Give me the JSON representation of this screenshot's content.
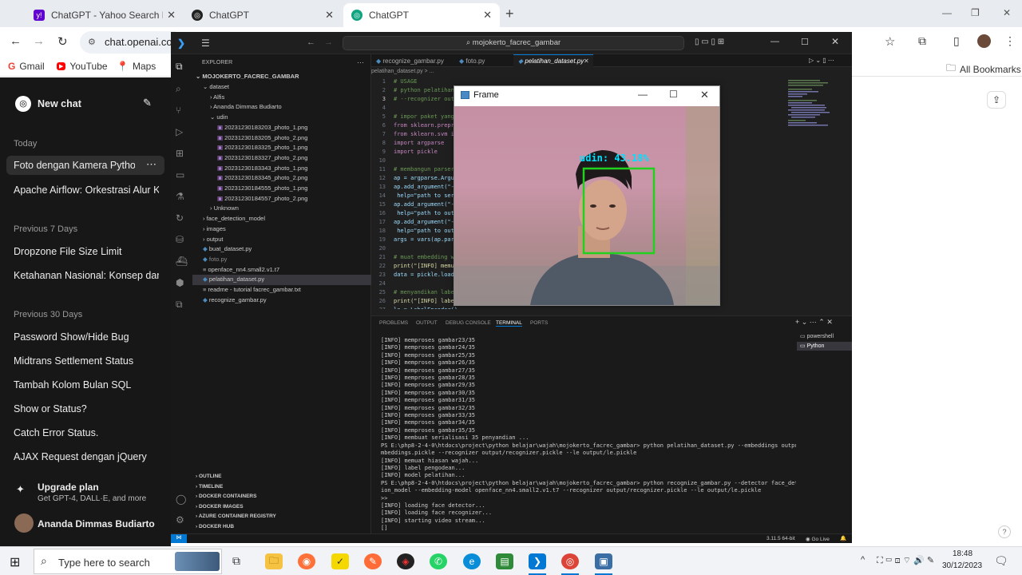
{
  "browser": {
    "tabs": [
      {
        "title": "ChatGPT - Yahoo Search Results",
        "icon": "yahoo-icon"
      },
      {
        "title": "ChatGPT",
        "icon": "openai-icon"
      },
      {
        "title": "ChatGPT",
        "icon": "openai-icon"
      }
    ],
    "new_tab": "+",
    "url": "chat.openai.com",
    "bookmarks": [
      "Gmail",
      "YouTube",
      "Maps"
    ],
    "all_bookmarks": "All Bookmarks",
    "window_controls": [
      "—",
      "❐",
      "✕"
    ]
  },
  "chatgpt": {
    "new_chat": "New chat",
    "sections": [
      {
        "label": "Today",
        "items": [
          "Foto dengan Kamera Python",
          "Apache Airflow: Orkestrasi Alur Kerja"
        ]
      },
      {
        "label": "Previous 7 Days",
        "items": [
          "Dropzone File Size Limit",
          "Ketahanan Nasional: Konsep dan"
        ]
      },
      {
        "label": "Previous 30 Days",
        "items": [
          "Password Show/Hide Bug",
          "Midtrans Settlement Status",
          "Tambah Kolom Bulan SQL",
          "Show or Status?",
          "Catch Error Status.",
          "AJAX Request dengan jQuery"
        ]
      }
    ],
    "upgrade_title": "Upgrade plan",
    "upgrade_sub": "Get GPT-4, DALL·E, and more",
    "user": "Ananda Dimmas Budiarto"
  },
  "vscode": {
    "search": "mojokerto_facrec_gambar",
    "explorer_title": "EXPLORER",
    "project": "MOJOKERTO_FACREC_GAMBAR",
    "tree": [
      {
        "label": "dataset",
        "indent": 1,
        "kind": "folder-open"
      },
      {
        "label": "Alfis",
        "indent": 2,
        "kind": "folder"
      },
      {
        "label": "Ananda Dimmas Budiarto",
        "indent": 2,
        "kind": "folder"
      },
      {
        "label": "udin",
        "indent": 2,
        "kind": "folder-open"
      },
      {
        "label": "20231230183203_photo_1.png",
        "indent": 3,
        "kind": "img"
      },
      {
        "label": "20231230183205_photo_2.png",
        "indent": 3,
        "kind": "img"
      },
      {
        "label": "20231230183325_photo_1.png",
        "indent": 3,
        "kind": "img"
      },
      {
        "label": "20231230183327_photo_2.png",
        "indent": 3,
        "kind": "img"
      },
      {
        "label": "20231230183343_photo_1.png",
        "indent": 3,
        "kind": "img"
      },
      {
        "label": "20231230183345_photo_2.png",
        "indent": 3,
        "kind": "img"
      },
      {
        "label": "20231230184555_photo_1.png",
        "indent": 3,
        "kind": "img"
      },
      {
        "label": "20231230184557_photo_2.png",
        "indent": 3,
        "kind": "img"
      },
      {
        "label": "Unknown",
        "indent": 2,
        "kind": "folder"
      },
      {
        "label": "face_detection_model",
        "indent": 1,
        "kind": "folder"
      },
      {
        "label": "images",
        "indent": 1,
        "kind": "folder"
      },
      {
        "label": "output",
        "indent": 1,
        "kind": "folder"
      },
      {
        "label": "buat_dataset.py",
        "indent": 1,
        "kind": "py"
      },
      {
        "label": "foto.py",
        "indent": 1,
        "kind": "py-dim"
      },
      {
        "label": "openface_nn4.small2.v1.t7",
        "indent": 1,
        "kind": "file"
      },
      {
        "label": "pelatihan_dataset.py",
        "indent": 1,
        "kind": "py-sel"
      },
      {
        "label": "readme - tutorial facrec_gambar.txt",
        "indent": 1,
        "kind": "txt"
      },
      {
        "label": "recognize_gambar.py",
        "indent": 1,
        "kind": "py"
      }
    ],
    "bottom_sections": [
      "OUTLINE",
      "TIMELINE",
      "DOCKER CONTAINERS",
      "DOCKER IMAGES",
      "AZURE CONTAINER REGISTRY",
      "DOCKER HUB"
    ],
    "editor_tabs": [
      "recognize_gambar.py",
      "foto.py",
      "pelatihan_dataset.py"
    ],
    "breadcrumb": "pelatihan_dataset.py > ...",
    "code": [
      "# USAGE",
      "# python pelatihan_dataset.py --embeddings output/embeddings.pickle",
      "#   --recognizer output/recognizer.pickle --le output/le.pickle",
      "",
      "# impor paket yang diperlukan",
      "from sklearn.preprocessing import LabelEncoder",
      "from sklearn.svm import SVC",
      "import argparse",
      "import pickle",
      "",
      "# membangun parser argumen dan mengurai argumen",
      "ap = argparse.ArgumentParser()",
      "ap.add_argument(\"-e\", \"--embeddings\", required=True,",
      "    help=\"path to serialized db of facial embeddings\")",
      "ap.add_argument(\"-r\", \"--recognizer\", required=True,",
      "    help=\"path to output model trained to recognize faces\")",
      "ap.add_argument(\"-l\", \"--le\", required=True,",
      "    help=\"path to output label encoder\")",
      "args = vars(ap.parse_args())",
      "",
      "# muat embedding wajah",
      "print(\"[INFO] memuat hiasan wajah...\")",
      "data = pickle.loads(open(args[\"embeddings\"], \"rb\").read())",
      "",
      "# menyandikan label",
      "print(\"[INFO] label pengodean...\")",
      "le = LabelEncoder()"
    ],
    "panel_tabs": [
      "PROBLEMS",
      "OUTPUT",
      "DEBUG CONSOLE",
      "TERMINAL",
      "PORTS"
    ],
    "terminal": [
      "[INFO] memproses gambar23/35",
      "[INFO] memproses gambar24/35",
      "[INFO] memproses gambar25/35",
      "[INFO] memproses gambar26/35",
      "[INFO] memproses gambar27/35",
      "[INFO] memproses gambar28/35",
      "[INFO] memproses gambar29/35",
      "[INFO] memproses gambar30/35",
      "[INFO] memproses gambar31/35",
      "[INFO] memproses gambar32/35",
      "[INFO] memproses gambar33/35",
      "[INFO] memproses gambar34/35",
      "[INFO] memproses gambar35/35",
      "[INFO] membuat serialisasi 35 penyandian ...",
      "PS E:\\php8-2-4-0\\htdocs\\project\\python belajar\\wajah\\mojokerto_facrec_gambar> python pelatihan_dataset.py --embeddings output/e",
      "mbeddings.pickle --recognizer output/recognizer.pickle --le output/le.pickle",
      "[INFO] memuat hiasan wajah...",
      "[INFO] label pengodean...",
      "[INFO] model pelatihan...",
      "PS E:\\php8-2-4-0\\htdocs\\project\\python belajar\\wajah\\mojokerto_facrec_gambar> python recognize_gambar.py --detector face_detect",
      "ion_model --embedding-model openface_nn4.small2.v1.t7 --recognizer output/recognizer.pickle --le output/le.pickle",
      ">>",
      "[INFO] loading face detector...",
      "[INFO] loading face recognizer...",
      "[INFO] starting video stream...",
      "[]"
    ],
    "terminals": [
      "powershell",
      "Python"
    ],
    "status_right": [
      "3.11.5 64-bit",
      "Go Live"
    ]
  },
  "frame": {
    "title": "Frame",
    "label": "udin: 43.18%",
    "confidence": 43.18
  },
  "taskbar": {
    "search": "Type here to search",
    "time": "18:48",
    "date": "30/12/2023"
  }
}
